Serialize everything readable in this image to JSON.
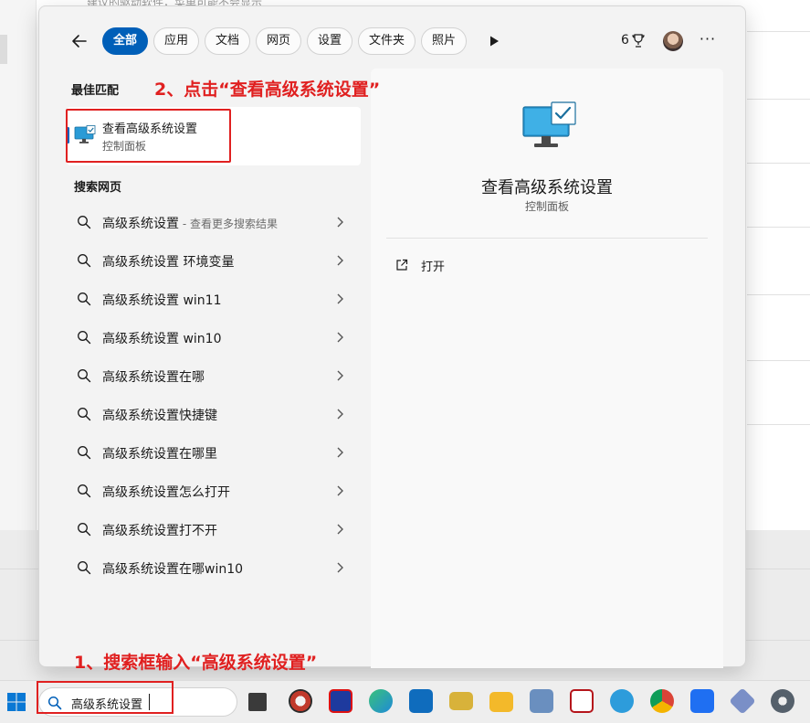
{
  "background": {
    "top_text": "建议的驱动软件，菜单可能不会显示"
  },
  "topbar": {
    "filters": [
      {
        "label": "全部",
        "active": true
      },
      {
        "label": "应用",
        "active": false
      },
      {
        "label": "文档",
        "active": false
      },
      {
        "label": "网页",
        "active": false
      },
      {
        "label": "设置",
        "active": false
      },
      {
        "label": "文件夹",
        "active": false
      },
      {
        "label": "照片",
        "active": false
      }
    ],
    "points": "6",
    "icons": [
      "back-arrow-icon",
      "play-icon",
      "trophy-icon",
      "avatar",
      "more-icon"
    ]
  },
  "best_match": {
    "section_label": "最佳匹配",
    "title": "查看高级系统设置",
    "subtitle": "控制面板"
  },
  "web_search": {
    "section_label": "搜索网页",
    "items": [
      {
        "text": "高级系统设置",
        "hint": " - 查看更多搜索结果"
      },
      {
        "text": "高级系统设置 环境变量",
        "hint": ""
      },
      {
        "text": "高级系统设置 win11",
        "hint": ""
      },
      {
        "text": "高级系统设置 win10",
        "hint": ""
      },
      {
        "text": "高级系统设置在哪",
        "hint": ""
      },
      {
        "text": "高级系统设置快捷键",
        "hint": ""
      },
      {
        "text": "高级系统设置在哪里",
        "hint": ""
      },
      {
        "text": "高级系统设置怎么打开",
        "hint": ""
      },
      {
        "text": "高级系统设置打不开",
        "hint": ""
      },
      {
        "text": "高级系统设置在哪win10",
        "hint": ""
      }
    ]
  },
  "detail": {
    "title": "查看高级系统设置",
    "subtitle": "控制面板",
    "actions": [
      {
        "label": "打开",
        "icon": "open-external-icon"
      }
    ]
  },
  "annotations": {
    "step1": "1、搜索框输入“高级系统设置”",
    "step2": "2、点击“查看高级系统设置”",
    "color": "#e02020"
  },
  "taskbar": {
    "search_value": "高级系统设置",
    "accent": "#005fb8",
    "apps": [
      {
        "name": "file-manager-app-icon",
        "color": "#2b2b2b"
      },
      {
        "name": "browser-app-icon",
        "color": "#c0392b"
      },
      {
        "name": "ggdb-app-icon",
        "color": "#1e3a9e"
      },
      {
        "name": "edge-app-icon",
        "color": "#1f8ad8"
      },
      {
        "name": "outlook-app-icon",
        "color": "#0f6cbd"
      },
      {
        "name": "device-app-icon",
        "color": "#d8b23a"
      },
      {
        "name": "folder-app-icon",
        "color": "#f3b92a"
      },
      {
        "name": "virtualbox-app-icon",
        "color": "#6a8fbf"
      },
      {
        "name": "vc-app-icon",
        "color": "#b5151b"
      },
      {
        "name": "chat-app-icon",
        "color": "#2d9cdb"
      },
      {
        "name": "chrome-app-icon",
        "color": "#db4437"
      },
      {
        "name": "feishu-app-icon",
        "color": "#1f6ff2"
      },
      {
        "name": "tools-app-icon",
        "color": "#7a8fc7"
      },
      {
        "name": "settings-app-icon",
        "color": "#55606b"
      }
    ]
  }
}
